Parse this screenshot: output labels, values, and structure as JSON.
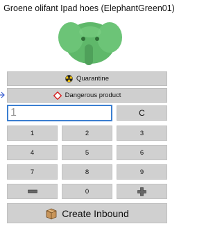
{
  "product": {
    "title": "Groene olifant Ipad hoes (ElephantGreen01)",
    "image_alt": "green elephant ipad case"
  },
  "status": {
    "quarantine_label": "Quarantine",
    "quarantine_icon": "radiation-icon",
    "dangerous_label": "Dangerous product",
    "dangerous_icon": "hazard-diamond-icon"
  },
  "quantity": {
    "value": "1"
  },
  "keypad": {
    "clear": "C",
    "k1": "1",
    "k2": "2",
    "k3": "3",
    "k4": "4",
    "k5": "5",
    "k6": "6",
    "k7": "7",
    "k8": "8",
    "k9": "9",
    "k0": "0",
    "minus_icon": "minus-icon",
    "plus_icon": "plus-icon"
  },
  "actions": {
    "create_label": "Create Inbound",
    "create_icon": "package-icon"
  },
  "colors": {
    "input_border": "#3b7fd1",
    "button_bg": "#d0d0d0",
    "hazard_red": "#d62020",
    "quarantine_yellow": "#f2c40f"
  }
}
